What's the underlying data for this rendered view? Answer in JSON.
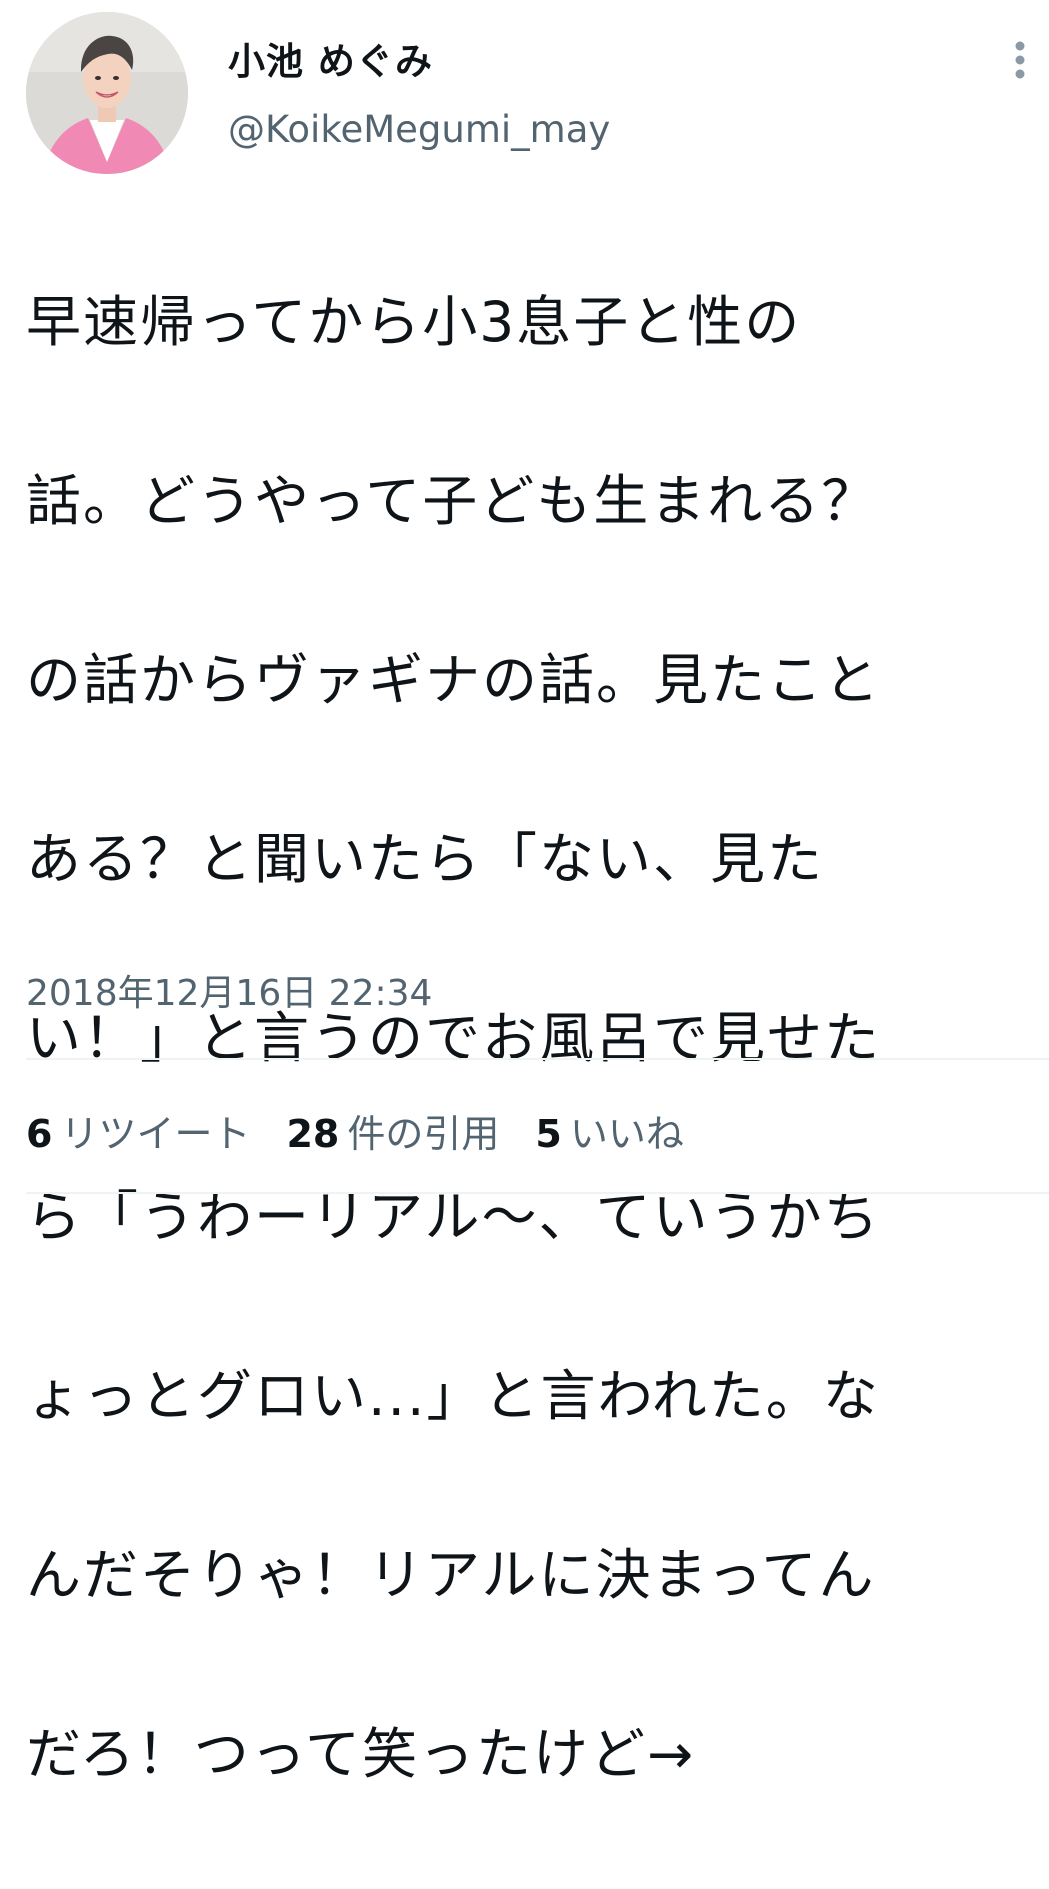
{
  "author": {
    "display_name": "小池 めぐみ",
    "handle": "@KoikeMegumi_may",
    "avatar": "profile-photo-woman-pink-jacket"
  },
  "menu": {
    "icon": "more-vertical-icon"
  },
  "tweet": {
    "text_lines": [
      "早速帰ってから小3息子と性の",
      "話。どうやって子ども生まれる？",
      "の話からヴァギナの話。見たこと",
      "ある？と聞いたら「ない、見た",
      "い！」と言うのでお風呂で見せた",
      "ら「うわーリアル〜、ていうかち",
      "ょっとグロい...」と言われた。な",
      "んだそりゃ！リアルに決まってん",
      "だろ！つって笑ったけど→"
    ],
    "timestamp": "2018年12月16日 22:34"
  },
  "stats": {
    "retweets": {
      "count": "6",
      "label": "リツイート"
    },
    "quotes": {
      "count": "28",
      "label": "件の引用"
    },
    "likes": {
      "count": "5",
      "label": "いいね"
    }
  },
  "colors": {
    "text_primary": "#0f1419",
    "text_secondary": "#536471",
    "divider": "#eff3f4",
    "avatar_jacket": "#f08ab5"
  }
}
